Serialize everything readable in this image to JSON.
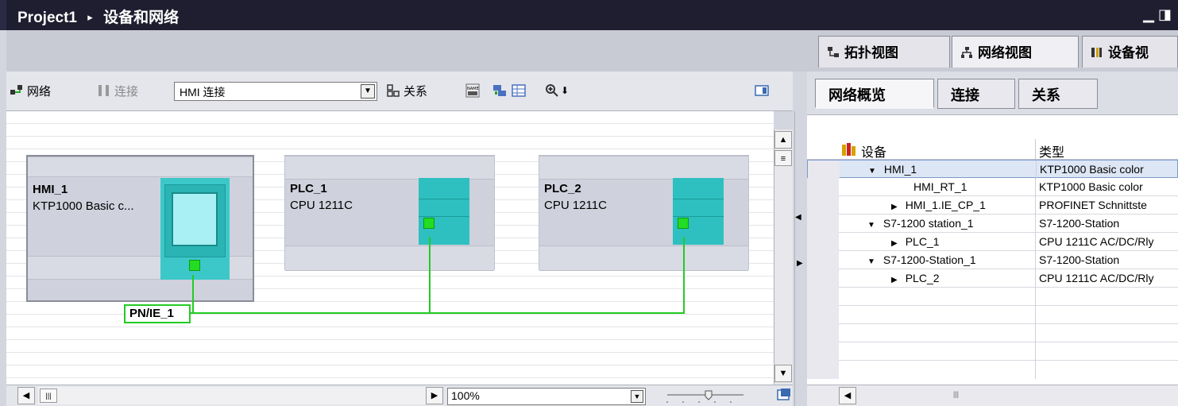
{
  "title": {
    "project": "Project1",
    "separator": "▸",
    "page": "设备和网络"
  },
  "view_tabs": [
    {
      "label": "拓扑视图",
      "icon": "topology-view-icon"
    },
    {
      "label": "网络视图",
      "icon": "network-view-icon"
    },
    {
      "label": "设备视",
      "icon": "device-view-icon"
    }
  ],
  "toolbar": {
    "network_label": "网络",
    "connect_label": "连接",
    "connection_type": "HMI 连接",
    "relation_label": "关系"
  },
  "stations": [
    {
      "name": "HMI_1",
      "type": "KTP1000 Basic c..."
    },
    {
      "name": "PLC_1",
      "type": "CPU 1211C"
    },
    {
      "name": "PLC_2",
      "type": "CPU 1211C"
    }
  ],
  "network": {
    "label": "PN/IE_1",
    "color": "#22cc22"
  },
  "zoom": {
    "value": "100%"
  },
  "right_tabs": [
    {
      "label": "网络概览"
    },
    {
      "label": "连接"
    },
    {
      "label": "关系"
    }
  ],
  "table": {
    "headers": {
      "device": "设备",
      "type": "类型"
    },
    "rows": [
      {
        "device": "HMI_1",
        "type": "KTP1000 Basic color",
        "expander": "▼",
        "level": 1
      },
      {
        "device": "HMI_RT_1",
        "type": "KTP1000 Basic color",
        "expander": "",
        "level": 2
      },
      {
        "device": "HMI_1.IE_CP_1",
        "type": "PROFINET Schnittste",
        "expander": "▶",
        "level": 2
      },
      {
        "device": "S7-1200 station_1",
        "type": "S7-1200-Station",
        "expander": "▼",
        "level": 1
      },
      {
        "device": "PLC_1",
        "type": "CPU 1211C AC/DC/Rly",
        "expander": "▶",
        "level": 2
      },
      {
        "device": "S7-1200-Station_1",
        "type": "S7-1200-Station",
        "expander": "▼",
        "level": 1
      },
      {
        "device": "PLC_2",
        "type": "CPU 1211C AC/DC/Rly",
        "expander": "▶",
        "level": 2
      }
    ]
  }
}
